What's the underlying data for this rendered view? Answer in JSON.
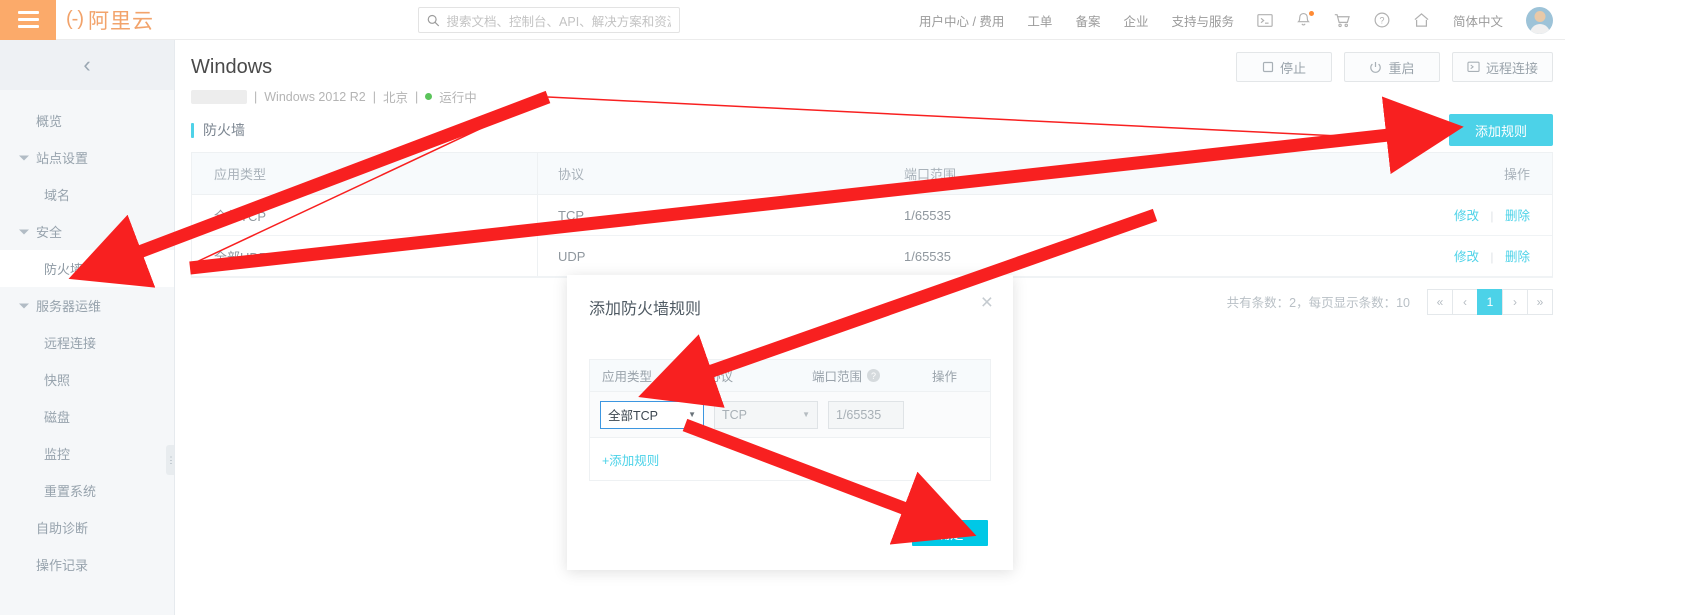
{
  "topbar": {
    "menu_icon": "hamburger-icon",
    "brand": "阿里云",
    "brand_mark": "(-)",
    "search_placeholder": "搜索文档、控制台、API、解决方案和资源",
    "nav_links": [
      "用户中心 / 费用",
      "工单",
      "备案",
      "企业",
      "支持与服务"
    ],
    "icons": [
      "terminal-icon",
      "bell-icon",
      "cart-icon",
      "help-icon",
      "home-icon"
    ],
    "language": "简体中文"
  },
  "sidebar": {
    "collapse_icon": "chevron-left-icon",
    "items": [
      {
        "label": "概览",
        "type": "item"
      },
      {
        "label": "站点设置",
        "type": "group"
      },
      {
        "label": "域名",
        "type": "child"
      },
      {
        "label": "安全",
        "type": "group"
      },
      {
        "label": "防火墙",
        "type": "child",
        "active": true
      },
      {
        "label": "服务器运维",
        "type": "group"
      },
      {
        "label": "远程连接",
        "type": "child"
      },
      {
        "label": "快照",
        "type": "child"
      },
      {
        "label": "磁盘",
        "type": "child"
      },
      {
        "label": "监控",
        "type": "child"
      },
      {
        "label": "重置系统",
        "type": "child"
      },
      {
        "label": "自助诊断",
        "type": "item"
      },
      {
        "label": "操作记录",
        "type": "item"
      }
    ]
  },
  "page": {
    "title": "Windows",
    "sub_os": "Windows 2012 R2",
    "sub_region": "北京",
    "sub_status": "运行中",
    "divider": "|",
    "actions": [
      {
        "label": "停止",
        "icon": "stop-icon"
      },
      {
        "label": "重启",
        "icon": "power-icon"
      },
      {
        "label": "远程连接",
        "icon": "monitor-icon"
      }
    ]
  },
  "firewall": {
    "section_title": "防火墙",
    "add_button": "添加规则",
    "columns": [
      "应用类型",
      "协议",
      "端口范围",
      "操作"
    ],
    "rows": [
      {
        "app_type": "全部TCP",
        "protocol": "TCP",
        "port_range": "1/65535",
        "edit": "修改",
        "delete": "删除"
      },
      {
        "app_type": "全部UDP",
        "protocol": "UDP",
        "port_range": "1/65535",
        "edit": "修改",
        "delete": "删除"
      }
    ],
    "pagination": {
      "info": "共有条数：2，每页显示条数：10",
      "first": "«",
      "prev": "‹",
      "current": "1",
      "next": "›",
      "last": "»"
    }
  },
  "modal": {
    "title": "添加防火墙规则",
    "close_icon": "close-icon",
    "columns": [
      "应用类型",
      "协议",
      "端口范围",
      "操作"
    ],
    "help_icon": "question-icon",
    "form": {
      "app_type_value": "全部TCP",
      "protocol_value": "TCP",
      "port_range_value": "1/65535",
      "dropdown_arrow": "▼"
    },
    "add_rule_link": "+添加规则",
    "confirm_button": "确定"
  },
  "colors": {
    "brand_orange": "#f2a36b",
    "accent_cyan": "#4cd2e8",
    "confirm_cyan": "#00c8e6",
    "status_green": "#5bc45b",
    "annotation_red": "#f22"
  }
}
